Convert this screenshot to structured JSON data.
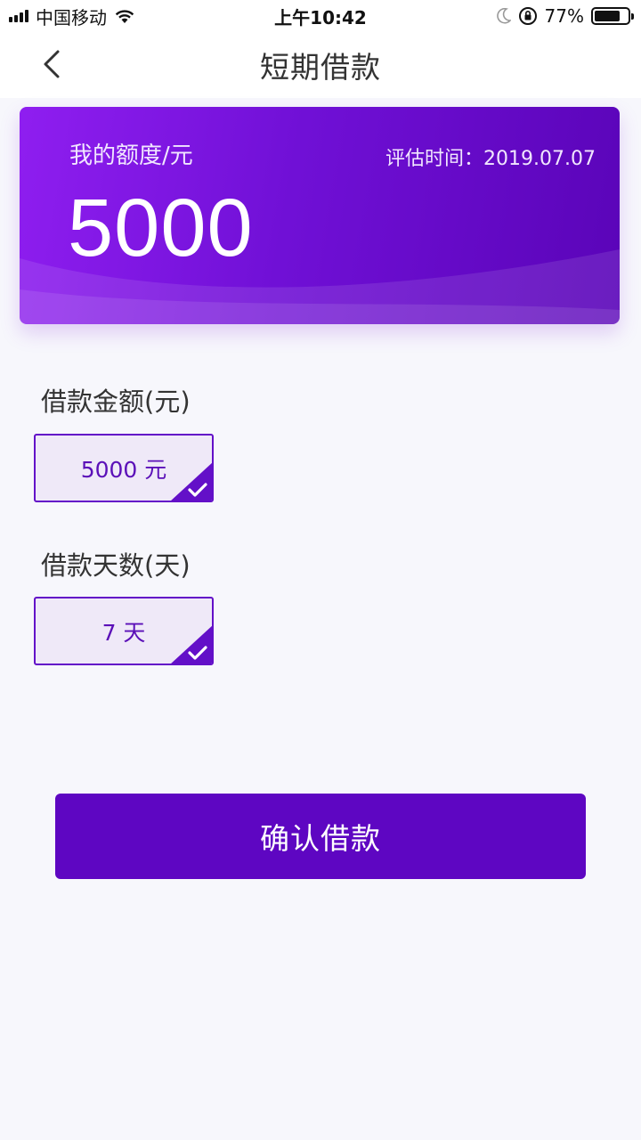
{
  "status_bar": {
    "carrier": "中国移动",
    "time": "上午10:42",
    "battery_text": "77%",
    "battery_level": 0.77
  },
  "nav": {
    "title": "短期借款",
    "back_icon": "chevron-left-icon"
  },
  "card": {
    "quota_label": "我的额度/元",
    "quota_amount": "5000",
    "eval_time": "评估时间：2019.07.07"
  },
  "loan_amount": {
    "label": "借款金额(元)",
    "selected_option": "5000 元"
  },
  "loan_days": {
    "label": "借款天数(天)",
    "selected_option": "7 天"
  },
  "confirm_button": "确认借款",
  "colors": {
    "primary": "#5e06c2",
    "card_gradient_start": "#8f1ef0",
    "card_gradient_end": "#5a04b8",
    "option_bg": "#efe9f8",
    "page_bg": "#f7f7fc"
  }
}
